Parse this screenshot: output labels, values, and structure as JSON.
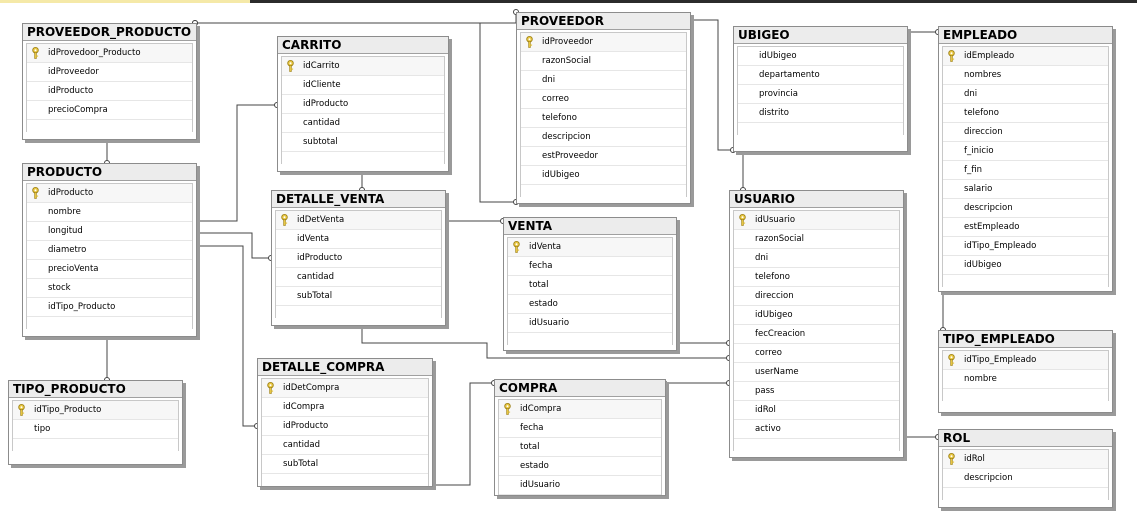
{
  "tables": [
    {
      "id": "proveedor_producto",
      "title": "PROVEEDOR_PRODUCTO",
      "columns": [
        "idProvedoor_Producto",
        "idProveedor",
        "idProducto",
        "precioCompra"
      ]
    },
    {
      "id": "producto",
      "title": "PRODUCTO",
      "columns": [
        "idProducto",
        "nombre",
        "longitud",
        "diametro",
        "precioVenta",
        "stock",
        "idTipo_Producto"
      ]
    },
    {
      "id": "tipo_producto",
      "title": "TIPO_PRODUCTO",
      "columns": [
        "idTipo_Producto",
        "tipo"
      ]
    },
    {
      "id": "carrito",
      "title": "CARRITO",
      "columns": [
        "idCarrito",
        "idCliente",
        "idProducto",
        "cantidad",
        "subtotal"
      ]
    },
    {
      "id": "detalle_venta",
      "title": "DETALLE_VENTA",
      "columns": [
        "idDetVenta",
        "idVenta",
        "idProducto",
        "cantidad",
        "subTotal"
      ]
    },
    {
      "id": "detalle_compra",
      "title": "DETALLE_COMPRA",
      "columns": [
        "idDetCompra",
        "idCompra",
        "idProducto",
        "cantidad",
        "subTotal"
      ]
    },
    {
      "id": "proveedor",
      "title": "PROVEEDOR",
      "columns": [
        "idProveedor",
        "razonSocial",
        "dni",
        "correo",
        "telefono",
        "descripcion",
        "estProveedor",
        "idUbigeo"
      ]
    },
    {
      "id": "venta",
      "title": "VENTA",
      "columns": [
        "idVenta",
        "fecha",
        "total",
        "estado",
        "idUsuario"
      ]
    },
    {
      "id": "compra",
      "title": "COMPRA",
      "columns": [
        "idCompra",
        "fecha",
        "total",
        "estado",
        "idUsuario"
      ]
    },
    {
      "id": "ubigeo",
      "title": "UBIGEO",
      "columns": [
        "idUbigeo",
        "departamento",
        "provincia",
        "distrito"
      ]
    },
    {
      "id": "usuario",
      "title": "USUARIO",
      "columns": [
        "idUsuario",
        "razonSocial",
        "dni",
        "telefono",
        "direccion",
        "idUbigeo",
        "fecCreacion",
        "correo",
        "userName",
        "pass",
        "idRol",
        "activo"
      ]
    },
    {
      "id": "empleado",
      "title": "EMPLEADO",
      "columns": [
        "idEmpleado",
        "nombres",
        "dni",
        "telefono",
        "direccion",
        "f_inicio",
        "f_fin",
        "salario",
        "descripcion",
        "estEmpleado",
        "idTipo_Empleado",
        "idUbigeo"
      ]
    },
    {
      "id": "tipo_empleado",
      "title": "TIPO_EMPLEADO",
      "columns": [
        "idTipo_Empleado",
        "nombre"
      ]
    },
    {
      "id": "rol",
      "title": "ROL",
      "columns": [
        "idRol",
        "descripcion"
      ]
    }
  ],
  "colors": {
    "key": "#e8c640",
    "line": "#444444",
    "header": "#ececec"
  }
}
